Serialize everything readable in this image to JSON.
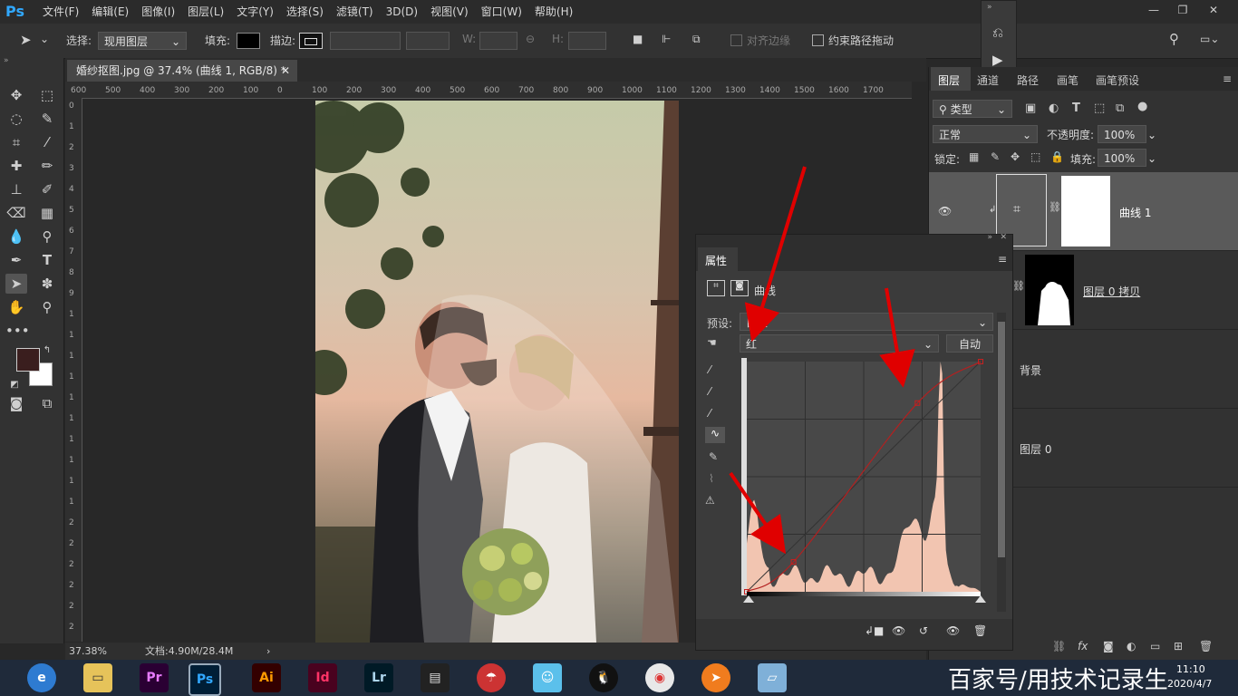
{
  "app": {
    "logo": "Ps"
  },
  "menu": [
    "文件(F)",
    "编辑(E)",
    "图像(I)",
    "图层(L)",
    "文字(Y)",
    "选择(S)",
    "滤镜(T)",
    "3D(D)",
    "视图(V)",
    "窗口(W)",
    "帮助(H)"
  ],
  "options": {
    "select_label": "选择:",
    "select_value": "现用图层",
    "fill_label": "填充:",
    "stroke_label": "描边:",
    "w_label": "W:",
    "h_label": "H:",
    "align_edges": "对齐边缘",
    "constrain_path": "约束路径拖动"
  },
  "document": {
    "tab_title": "婚纱抠图.jpg @ 37.4% (曲线 1, RGB/8) *",
    "zoom": "37.38%",
    "doc_size": "文档:4.90M/28.4M"
  },
  "ruler": {
    "h": [
      "600",
      "500",
      "400",
      "300",
      "200",
      "100",
      "0",
      "100",
      "200",
      "300",
      "400",
      "500",
      "600",
      "700",
      "800",
      "900",
      "1000",
      "1100",
      "1200",
      "1300",
      "1400",
      "1500",
      "1600",
      "1700"
    ],
    "v": [
      "0",
      "1",
      "2",
      "3",
      "4",
      "5",
      "6",
      "7",
      "8",
      "9",
      "1",
      "1",
      "1",
      "1",
      "1",
      "1",
      "1",
      "1",
      "1",
      "1",
      "2",
      "2",
      "2",
      "2",
      "2",
      "2"
    ]
  },
  "layers_panel": {
    "tabs": [
      "图层",
      "通道",
      "路径",
      "画笔",
      "画笔预设"
    ],
    "filter_kind": "类型",
    "blend_mode": "正常",
    "opacity_label": "不透明度:",
    "opacity_value": "100%",
    "lock_label": "锁定:",
    "fill_label": "填充:",
    "fill_value": "100%",
    "layers": [
      {
        "name": "曲线 1"
      },
      {
        "name": "图层 0 拷贝"
      },
      {
        "name": "背景"
      },
      {
        "name": "图层 0"
      }
    ]
  },
  "properties_panel": {
    "title": "属性",
    "subtitle": "曲线",
    "preset_label": "预设:",
    "preset_value": "自定",
    "channel_value": "红",
    "auto_button": "自动"
  },
  "curve": {
    "points": [
      [
        0,
        0
      ],
      [
        0.2,
        0.13
      ],
      [
        0.73,
        0.82
      ],
      [
        1,
        1
      ]
    ]
  },
  "taskbar": {
    "apps": [
      "Pr",
      "Ps",
      "Ai",
      "Id",
      "Lr"
    ],
    "time": "11:10",
    "date": "2020/4/7",
    "watermark": "百家号/用技术记录生"
  },
  "colors": {
    "accent": "#31a8ff",
    "arrow": "#e00000",
    "histogram": "#f2c5b1"
  }
}
